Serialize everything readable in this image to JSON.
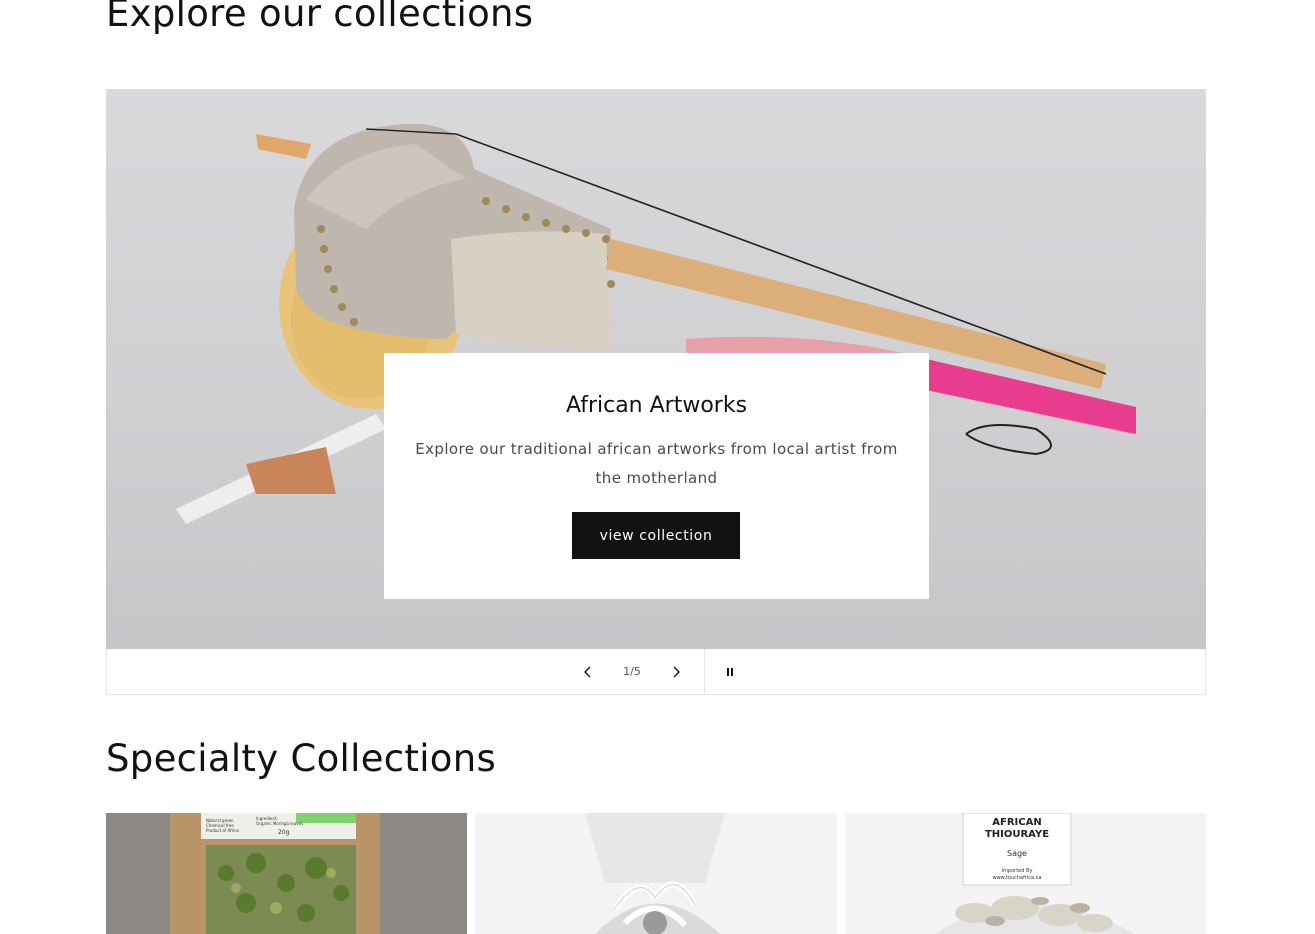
{
  "sections": {
    "explore_title": "Explore our collections",
    "specialty_title": "Specialty Collections"
  },
  "slideshow": {
    "heading": "African Artworks",
    "text": "Explore our traditional african artworks from local artist from the motherland",
    "button_label": "view collection",
    "counter": "1/5",
    "current": 1,
    "total": 5
  },
  "specialty_cards": [
    {
      "image": "moringa-leaves-pack",
      "label_lines": [
        "Natural green",
        "Chemical free",
        "Product of Africa",
        "Ingredient:",
        "Organic Moringa leaves",
        "20g"
      ]
    },
    {
      "image": "gift-bag-with-ribbon"
    },
    {
      "image": "african-thiouraye-sage-bag",
      "label_lines": [
        "AFRICAN",
        "THIOURAYE",
        "Sage",
        "Imported By",
        "www.touchafrica.ca"
      ]
    }
  ],
  "icons": {
    "prev": "chevron-left-icon",
    "next": "chevron-right-icon",
    "pause": "pause-icon"
  }
}
